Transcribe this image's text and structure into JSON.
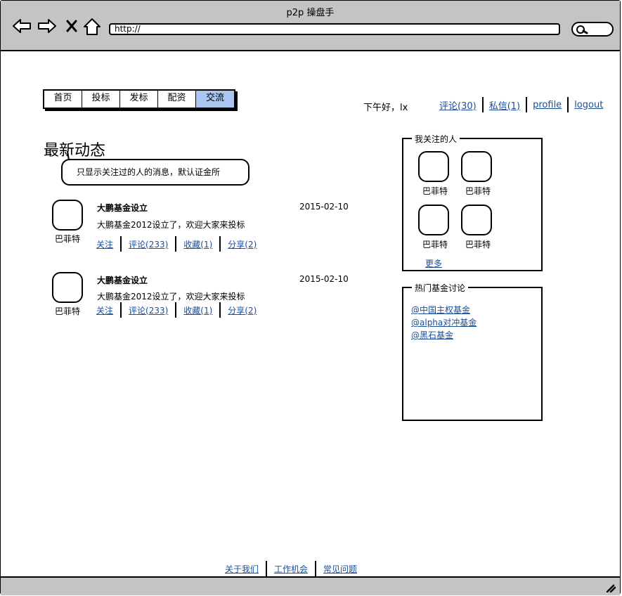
{
  "window": {
    "title": "p2p 操盘手"
  },
  "browser": {
    "url": "http://",
    "icons": [
      "back-arrow-icon",
      "forward-arrow-icon",
      "close-x-icon",
      "home-icon",
      "search-icon"
    ]
  },
  "nav": {
    "tabs": [
      {
        "label": "首页"
      },
      {
        "label": "投标"
      },
      {
        "label": "发标"
      },
      {
        "label": "配资"
      },
      {
        "label": "交流"
      }
    ],
    "active_tab": "交流"
  },
  "header": {
    "greeting": "下午好，lx",
    "links": [
      {
        "label": "评论(30)"
      },
      {
        "label": "私信(1)"
      },
      {
        "label": "profile"
      },
      {
        "label": "logout"
      }
    ]
  },
  "main": {
    "title": "最新动态",
    "note": "只显示关注过的人的消息，默认证金所",
    "feed": [
      {
        "author": "巴菲特",
        "title": "大鹏基金设立",
        "date": "2015-02-10",
        "body": "大鹏基金2012设立了，欢迎大家来投标",
        "actions": [
          "关注",
          "评论(233)",
          "收藏(1)",
          "分享(2)"
        ]
      },
      {
        "author": "巴菲特",
        "title": "大鹏基金设立",
        "date": "2015-02-10",
        "body": "大鹏基金2012设立了，欢迎大家来投标",
        "actions": [
          "关注",
          "评论(233)",
          "收藏(1)",
          "分享(2)"
        ]
      }
    ]
  },
  "sidebar": {
    "following": {
      "title": "我关注的人",
      "people": [
        "巴菲特",
        "巴菲特",
        "巴菲特",
        "巴菲特"
      ],
      "more": "更多"
    },
    "hot_funds": {
      "title": "热门基金讨论",
      "items": [
        "@中国主权基金",
        "@alpha对冲基金",
        "@黑石基金"
      ]
    }
  },
  "footer": {
    "links": [
      "关于我们",
      "工作机会",
      "常见问题"
    ]
  },
  "colors": {
    "chrome": "#c4c4c4",
    "active_tab": "#a9c5f0",
    "link": "#1b4e9b"
  }
}
